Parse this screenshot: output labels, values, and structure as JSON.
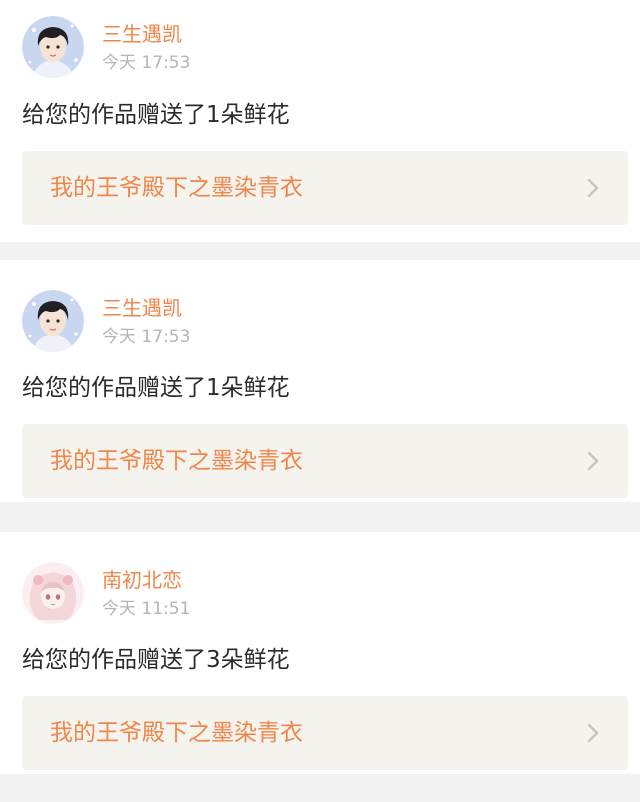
{
  "notifications": [
    {
      "username": "三生遇凯",
      "timestamp": "今天 17:53",
      "message": "给您的作品赠送了1朵鲜花",
      "work_title": "我的王爷殿下之墨染青衣",
      "avatar_icon": "user-avatar-boy"
    },
    {
      "username": "三生遇凯",
      "timestamp": "今天 17:53",
      "message": "给您的作品赠送了1朵鲜花",
      "work_title": "我的王爷殿下之墨染青衣",
      "avatar_icon": "user-avatar-boy"
    },
    {
      "username": "南初北恋",
      "timestamp": "今天 11:51",
      "message": "给您的作品赠送了3朵鲜花",
      "work_title": "我的王爷殿下之墨染青衣",
      "avatar_icon": "user-avatar-anime-girl"
    }
  ],
  "colors": {
    "accent": "#f0864a",
    "timestamp": "#b5b5b5",
    "text": "#2b2b2b",
    "link_bg": "#f4f3ee",
    "divider_bg": "#f2f2f2"
  }
}
